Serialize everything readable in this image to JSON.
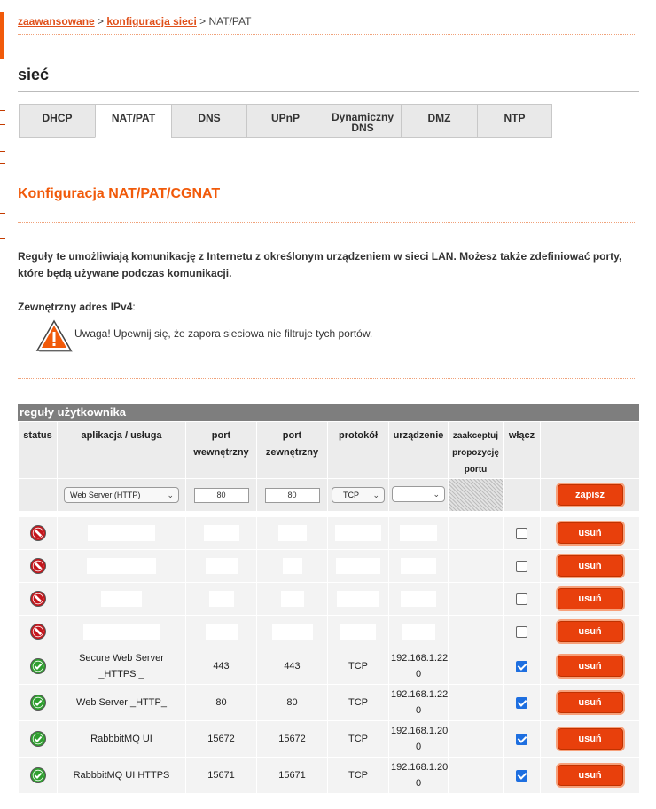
{
  "breadcrumb": {
    "items": [
      "zaawansowane",
      "konfiguracja sieci"
    ],
    "separator": ">",
    "current": "NAT/PAT"
  },
  "page_title": "sieć",
  "tabs": [
    {
      "label": "DHCP",
      "active": false
    },
    {
      "label": "NAT/PAT",
      "active": true
    },
    {
      "label": "DNS",
      "active": false
    },
    {
      "label": "UPnP",
      "active": false
    },
    {
      "label": "Dynamiczny DNS",
      "active": false
    },
    {
      "label": "DMZ",
      "active": false
    },
    {
      "label": "NTP",
      "active": false
    }
  ],
  "section_title": "Konfiguracja NAT/PAT/CGNAT",
  "intro": "Reguły te umożliwiają komunikację z Internetu z określonym urządzeniem w sieci LAN. Możesz także zdefiniować porty, które będą używane podczas komunikacji.",
  "external_ip": {
    "label": "Zewnętrzny adres IPv4",
    "suffix": ":",
    "value": ""
  },
  "warning": {
    "icon": "warning-triangle-icon",
    "text": "Uwaga! Upewnij się, że zapora sieciowa nie filtruje tych portów."
  },
  "rules_header": "reguły użytkownika",
  "columns": {
    "status": "status",
    "app": "aplikacja / usługa",
    "port_internal": "port wewnętrzny",
    "port_external": "port zewnętrzny",
    "protocol": "protokół",
    "device": "urządzenie",
    "accept_port": "zaakceptuj propozycję portu",
    "enable": "włącz"
  },
  "new_rule": {
    "app_selected": "Web Server (HTTP)",
    "port_internal": "80",
    "port_external": "80",
    "protocol_selected": "TCP",
    "device_selected": "",
    "save_label": "zapisz"
  },
  "rules": [
    {
      "status": "disabled",
      "app": "",
      "port_internal": "",
      "port_external": "",
      "protocol": "",
      "device": "",
      "enabled": false,
      "delete_label": "usuń",
      "redacted": true
    },
    {
      "status": "disabled",
      "app": "",
      "port_internal": "",
      "port_external": "",
      "protocol": "",
      "device": "",
      "enabled": false,
      "delete_label": "usuń",
      "redacted": true
    },
    {
      "status": "disabled",
      "app": "",
      "port_internal": "",
      "port_external": "",
      "protocol": "",
      "device": "",
      "enabled": false,
      "delete_label": "usuń",
      "redacted": true
    },
    {
      "status": "disabled",
      "app": "",
      "port_internal": "",
      "port_external": "",
      "protocol": "",
      "device": "",
      "enabled": false,
      "delete_label": "usuń",
      "redacted": true
    },
    {
      "status": "enabled",
      "app": "Secure Web Server _HTTPS _",
      "port_internal": "443",
      "port_external": "443",
      "protocol": "TCP",
      "device": "192.168.1.22 0",
      "enabled": true,
      "delete_label": "usuń"
    },
    {
      "status": "enabled",
      "app": "Web Server _HTTP_",
      "port_internal": "80",
      "port_external": "80",
      "protocol": "TCP",
      "device": "192.168.1.22 0",
      "enabled": true,
      "delete_label": "usuń"
    },
    {
      "status": "enabled",
      "app": "RabbbitMQ UI",
      "port_internal": "15672",
      "port_external": "15672",
      "protocol": "TCP",
      "device": "192.168.1.20 0",
      "enabled": true,
      "delete_label": "usuń"
    },
    {
      "status": "enabled",
      "app": "RabbbitMQ UI HTTPS",
      "port_internal": "15671",
      "port_external": "15671",
      "protocol": "TCP",
      "device": "192.168.1.20 0",
      "enabled": true,
      "delete_label": "usuń"
    }
  ],
  "colors": {
    "accent": "#f15a0a",
    "button": "#e8400c",
    "header_bg": "#7e7e7e",
    "checkbox_on": "#1e6fe0",
    "status_ok": "#2f9e2f",
    "status_off": "#c4161c"
  }
}
